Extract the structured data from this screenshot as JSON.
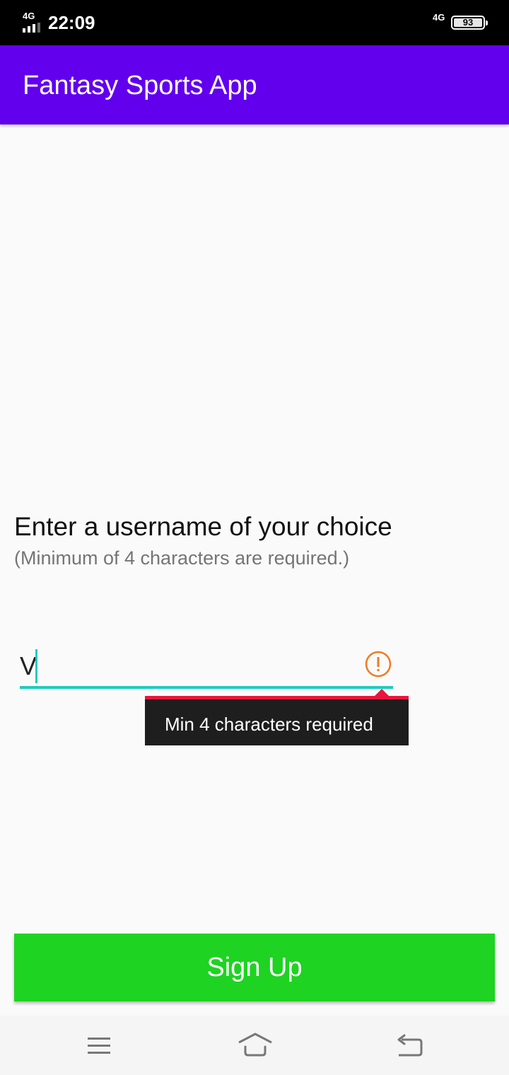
{
  "status_bar": {
    "network_left": "4G",
    "time": "22:09",
    "network_right": "4G",
    "battery": "93"
  },
  "app_bar": {
    "title": "Fantasy Sports App"
  },
  "form": {
    "prompt": "Enter a username of your choice",
    "hint": "(Minimum of 4 characters are required.)",
    "username_value": "V",
    "error_message": "Min 4 characters required"
  },
  "actions": {
    "signup_label": "Sign Up"
  },
  "colors": {
    "app_bar": "#6200ee",
    "accent": "#1ecbc0",
    "error": "#e8163c",
    "warning_icon": "#f07a22",
    "signup_button": "#1ed322"
  },
  "icons": {
    "error": "error-exclamation-icon",
    "nav_menu": "menu-icon",
    "nav_home": "home-icon",
    "nav_back": "back-icon"
  }
}
